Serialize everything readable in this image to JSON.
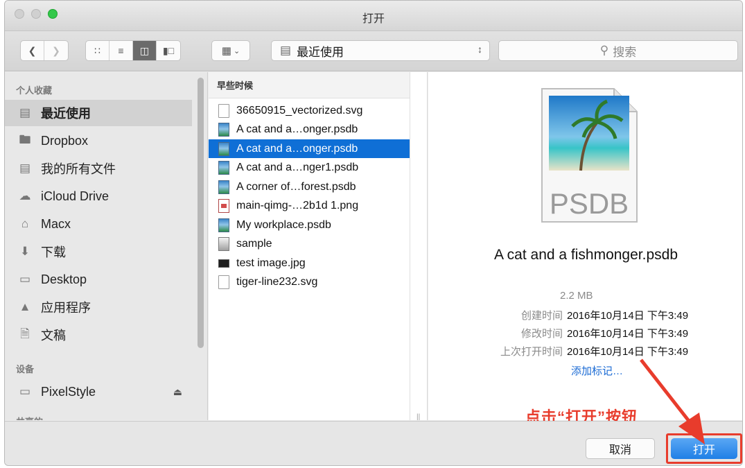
{
  "window": {
    "title": "打开"
  },
  "toolbar": {
    "back_icon": "chevron-left",
    "forward_icon": "chevron-right",
    "view_modes": [
      "icon-view",
      "list-view",
      "column-view",
      "coverflow-view"
    ],
    "arrange_icon": "grid-arrange",
    "location": "最近使用",
    "search_placeholder": "搜索"
  },
  "sidebar": {
    "favorites_header": "个人收藏",
    "favorites": [
      {
        "label": "最近使用",
        "icon": "recents-icon",
        "selected": true
      },
      {
        "label": "Dropbox",
        "icon": "folder-icon",
        "selected": false
      },
      {
        "label": "我的所有文件",
        "icon": "all-files-icon",
        "selected": false
      },
      {
        "label": "iCloud Drive",
        "icon": "cloud-icon",
        "selected": false
      },
      {
        "label": "Macx",
        "icon": "home-icon",
        "selected": false
      },
      {
        "label": "下载",
        "icon": "download-icon",
        "selected": false
      },
      {
        "label": "Desktop",
        "icon": "desktop-icon",
        "selected": false
      },
      {
        "label": "应用程序",
        "icon": "applications-icon",
        "selected": false
      },
      {
        "label": "文稿",
        "icon": "documents-icon",
        "selected": false
      }
    ],
    "devices_header": "设备",
    "devices": [
      {
        "label": "PixelStyle",
        "icon": "drive-icon"
      }
    ],
    "shared_header": "共享的"
  },
  "file_column": {
    "header": "早些时候",
    "files": [
      {
        "name": "36650915_vectorized.svg",
        "type": "doc",
        "selected": false
      },
      {
        "name": "A cat and a…onger.psdb",
        "type": "img",
        "selected": false
      },
      {
        "name": "A cat and a…onger.psdb",
        "type": "img",
        "selected": true
      },
      {
        "name": "A cat and a…nger1.psdb",
        "type": "img",
        "selected": false
      },
      {
        "name": "A corner of…forest.psdb",
        "type": "img",
        "selected": false
      },
      {
        "name": "main-qimg-…2b1d 1.png",
        "type": "png",
        "selected": false
      },
      {
        "name": "My workplace.psdb",
        "type": "img",
        "selected": false
      },
      {
        "name": "sample",
        "type": "app",
        "selected": false
      },
      {
        "name": "test image.jpg",
        "type": "jpg",
        "selected": false
      },
      {
        "name": "tiger-line232.svg",
        "type": "doc",
        "selected": false
      }
    ]
  },
  "preview": {
    "file_badge": "PSDB",
    "file_name": "A cat and a fishmonger.psdb",
    "size": "2.2 MB",
    "created_label": "创建时间",
    "created_value": "2016年10月14日 下午3:49",
    "modified_label": "修改时间",
    "modified_value": "2016年10月14日 下午3:49",
    "opened_label": "上次打开时间",
    "opened_value": "2016年10月14日 下午3:49",
    "add_tags": "添加标记…",
    "annotation": "点击“打开”按钮"
  },
  "buttons": {
    "cancel": "取消",
    "open": "打开"
  },
  "colors": {
    "accent": "#1f7fe6",
    "selection": "#0f6fd6",
    "annotation": "#e83c2c"
  }
}
